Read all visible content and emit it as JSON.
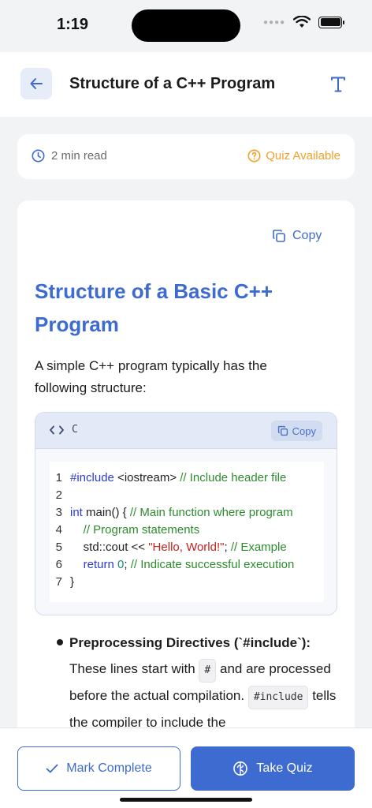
{
  "status": {
    "time": "1:19"
  },
  "header": {
    "title": "Structure of a C++ Program"
  },
  "meta": {
    "read_time": "2 min read",
    "quiz_label": "Quiz Available"
  },
  "content": {
    "copy_label": "Copy",
    "title": "Structure of a Basic C++ Program",
    "intro": "A simple C++ program typically has the following structure:",
    "code": {
      "language": "C",
      "copy_label": "Copy",
      "lines": [
        {
          "n": "1",
          "parts": [
            {
              "t": "#include",
              "c": "kw"
            },
            {
              "t": " <iostream> ",
              "c": ""
            },
            {
              "t": "// Include header file",
              "c": "cm"
            }
          ]
        },
        {
          "n": "2",
          "parts": []
        },
        {
          "n": "3",
          "parts": [
            {
              "t": "int",
              "c": "kw"
            },
            {
              "t": " main() { ",
              "c": ""
            },
            {
              "t": "// Main function where program",
              "c": "cm"
            }
          ]
        },
        {
          "n": "4",
          "parts": [
            {
              "t": "    ",
              "c": ""
            },
            {
              "t": "// Program statements",
              "c": "cm"
            }
          ]
        },
        {
          "n": "5",
          "parts": [
            {
              "t": "    std::cout << ",
              "c": ""
            },
            {
              "t": "\"Hello, World!\"",
              "c": "st"
            },
            {
              "t": "; ",
              "c": ""
            },
            {
              "t": "// Example",
              "c": "cm"
            }
          ]
        },
        {
          "n": "6",
          "parts": [
            {
              "t": "    ",
              "c": ""
            },
            {
              "t": "return",
              "c": "kw"
            },
            {
              "t": " ",
              "c": ""
            },
            {
              "t": "0",
              "c": "nm"
            },
            {
              "t": "; ",
              "c": ""
            },
            {
              "t": "// Indicate successful execution",
              "c": "cm"
            }
          ]
        },
        {
          "n": "7",
          "parts": [
            {
              "t": "}",
              "c": ""
            }
          ]
        }
      ]
    },
    "bullet": {
      "heading": "Preprocessing Directives (`#include`):",
      "text_1": "These lines start with",
      "code_1": "#",
      "text_2": "and are processed before the actual compilation.",
      "code_2": "#include",
      "text_3": "tells the compiler to include the"
    }
  },
  "actions": {
    "mark_complete": "Mark Complete",
    "take_quiz": "Take Quiz"
  },
  "colors": {
    "accent": "#3d6bd0",
    "quiz": "#f0a12a",
    "background": "#f2f3f5"
  }
}
